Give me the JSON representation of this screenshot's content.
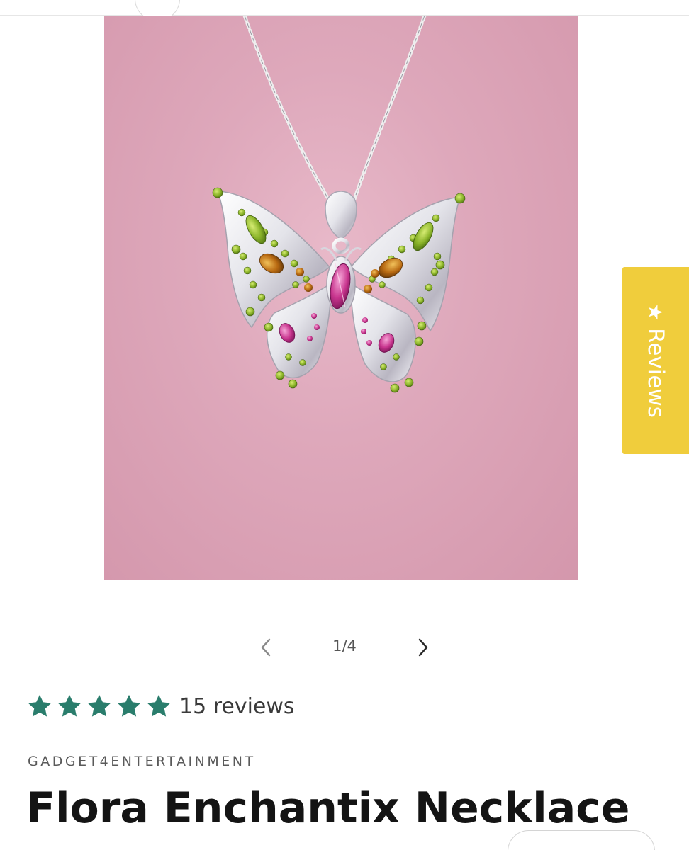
{
  "colors": {
    "review_star": "#2a7d6c",
    "reviews_tab_bg": "#f0cd3c",
    "image_bg": "#dea8bb"
  },
  "gallery": {
    "image_alt": "Flora Enchantix Necklace",
    "counter": "1/4",
    "prev_icon": "chevron-left-icon",
    "next_icon": "chevron-right-icon"
  },
  "reviews_tab": {
    "icon": "star-icon",
    "star": "★",
    "label": "Reviews"
  },
  "rating": {
    "value": 5,
    "max": 5,
    "count_label": "15 reviews"
  },
  "product": {
    "vendor": "GADGET4ENTERTAINMENT",
    "title": "Flora Enchantix Necklace"
  }
}
